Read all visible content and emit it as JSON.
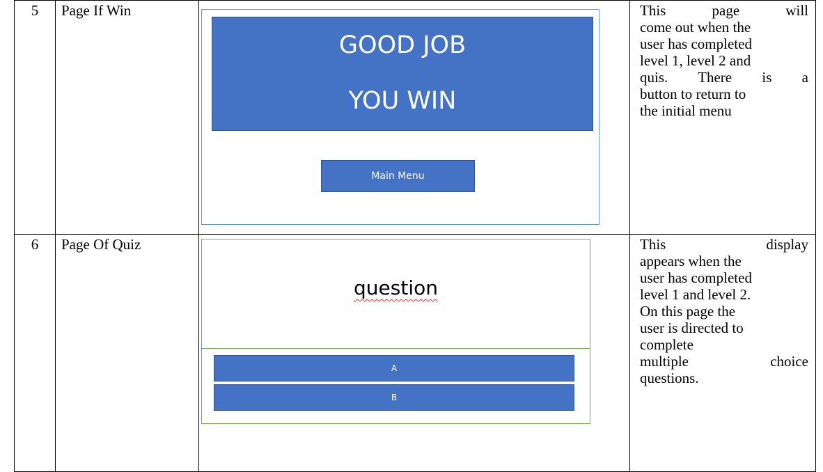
{
  "rows": [
    {
      "number": "5",
      "page_name": "Page If Win",
      "mockup": {
        "line1": "GOOD JOB",
        "line2": "YOU WIN",
        "button_label": "Main Menu"
      },
      "description_lines": [
        "This page will",
        "come out when the",
        "user has completed",
        "level 1, level 2 and",
        "quis. There is a",
        "button to return to",
        "the initial menu"
      ]
    },
    {
      "number": "6",
      "page_name": "Page Of Quiz",
      "mockup": {
        "question": "question",
        "option_a": "A",
        "option_b": "B"
      },
      "description_lines": [
        "This display",
        "appears when the",
        "user has completed",
        "level 1 and level 2.",
        "On this page the",
        "user is directed to",
        "complete",
        "multiple choice",
        "questions."
      ]
    }
  ],
  "colors": {
    "mockup_blue": "#4472c4",
    "frame_blue": "#5b9bd5",
    "frame_green": "#70ad47",
    "spellcheck_red": "#e03030"
  }
}
